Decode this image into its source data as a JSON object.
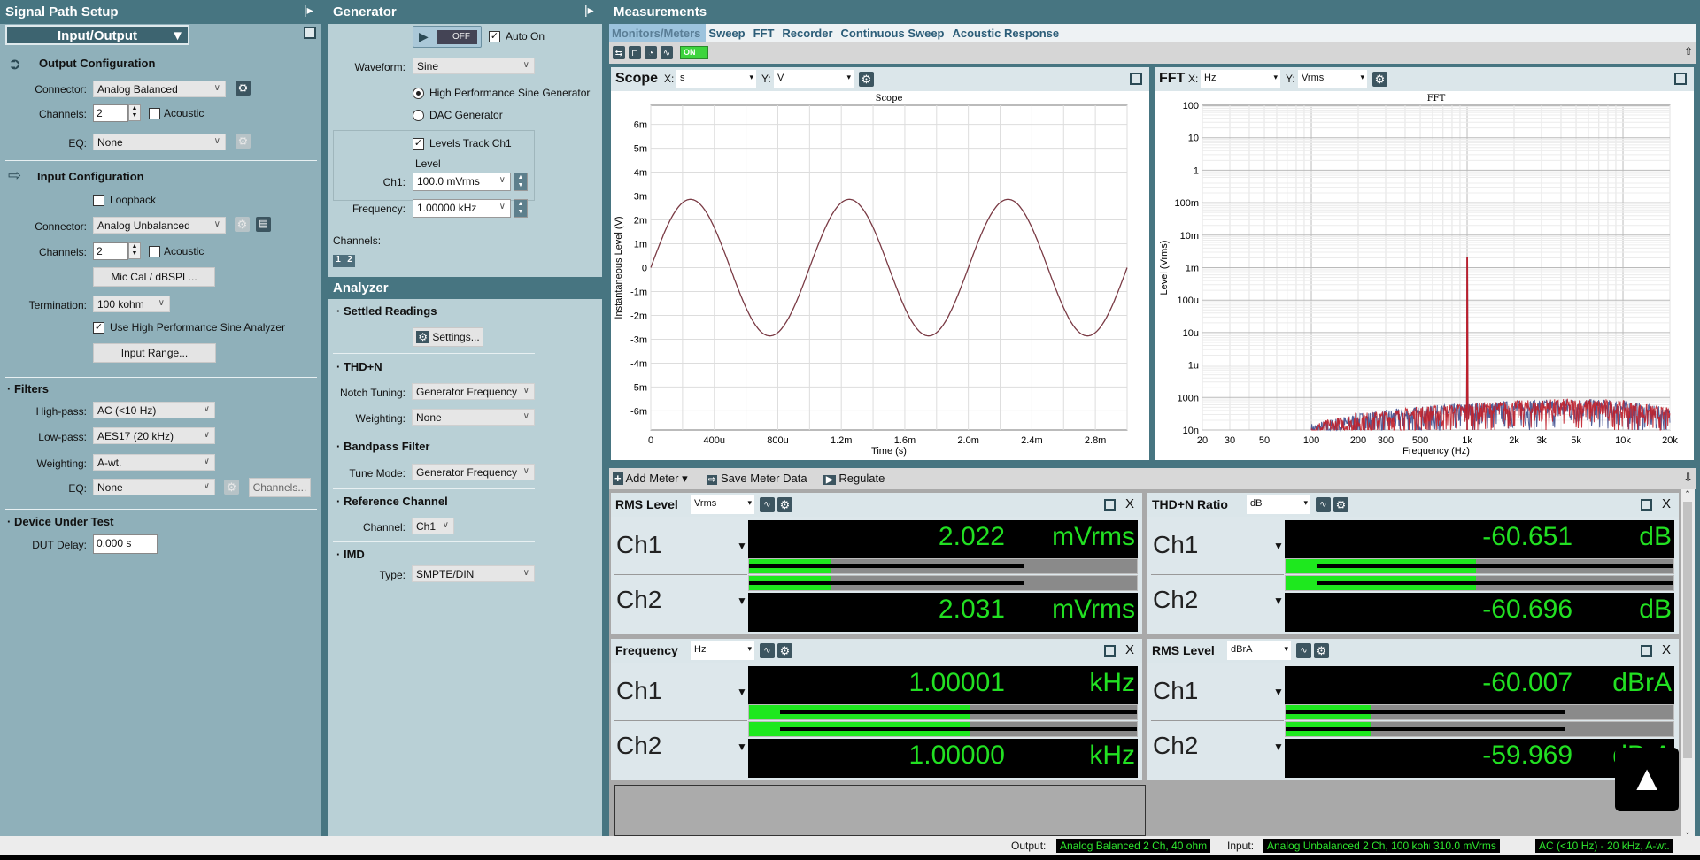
{
  "signal_path": {
    "title": "Signal Path Setup",
    "view": "Input/Output",
    "output": {
      "heading": "Output Configuration",
      "connector_label": "Connector:",
      "connector": "Analog Balanced",
      "channels_label": "Channels:",
      "channels": "2",
      "acoustic": "Acoustic",
      "acoustic_checked": false,
      "eq_label": "EQ:",
      "eq": "None"
    },
    "input": {
      "heading": "Input Configuration",
      "loopback": "Loopback",
      "loopback_checked": false,
      "connector_label": "Connector:",
      "connector": "Analog Unbalanced",
      "channels_label": "Channels:",
      "channels": "2",
      "acoustic": "Acoustic",
      "acoustic_checked": false,
      "mic_cal": "Mic Cal / dBSPL...",
      "termination_label": "Termination:",
      "termination": "100 kohm",
      "use_hp": "Use High Performance Sine Analyzer",
      "use_hp_checked": true,
      "input_range": "Input Range..."
    },
    "filters": {
      "heading": "Filters",
      "highpass_label": "High-pass:",
      "highpass": "AC (<10 Hz)",
      "lowpass_label": "Low-pass:",
      "lowpass": "AES17 (20 kHz)",
      "weighting_label": "Weighting:",
      "weighting": "A-wt.",
      "eq_label": "EQ:",
      "eq": "None",
      "channels_button": "Channels..."
    },
    "dut": {
      "heading": "Device Under Test",
      "delay_label": "DUT Delay:",
      "delay": "0.000 s"
    }
  },
  "generator": {
    "title": "Generator",
    "state": "OFF",
    "auto_on": "Auto On",
    "auto_on_checked": true,
    "waveform_label": "Waveform:",
    "waveform": "Sine",
    "hp_sine": "High Performance Sine Generator",
    "dac": "DAC Generator",
    "selected": "hp_sine",
    "levels_track": "Levels Track Ch1",
    "levels_track_checked": true,
    "level_label": "Level",
    "ch1_label": "Ch1:",
    "ch1": "100.0 mVrms",
    "frequency_label": "Frequency:",
    "frequency": "1.00000 kHz",
    "channels_label": "Channels:",
    "channel_buttons": [
      "1",
      "2"
    ]
  },
  "analyzer": {
    "title": "Analyzer",
    "settled": {
      "heading": "Settled Readings",
      "settings": "Settings..."
    },
    "thdn": {
      "heading": "THD+N",
      "notch_label": "Notch Tuning:",
      "notch": "Generator Frequency",
      "weighting_label": "Weighting:",
      "weighting": "None"
    },
    "bandpass": {
      "heading": "Bandpass Filter",
      "tune_label": "Tune Mode:",
      "tune": "Generator Frequency"
    },
    "reference": {
      "heading": "Reference Channel",
      "channel_label": "Channel:",
      "channel": "Ch1"
    },
    "imd": {
      "heading": "IMD",
      "type_label": "Type:",
      "type": "SMPTE/DIN"
    }
  },
  "measurements": {
    "title": "Measurements",
    "tabs": [
      "Monitors/Meters",
      "Sweep",
      "FFT",
      "Recorder",
      "Continuous Sweep",
      "Acoustic Response"
    ],
    "active_tab": 0,
    "monitor_toggle": "ON",
    "scope": {
      "title": "Scope",
      "x_label": "X:",
      "x_unit": "s",
      "y_label": "Y:",
      "y_unit": "V"
    },
    "fft": {
      "title": "FFT",
      "x_label": "X:",
      "x_unit": "Hz",
      "y_label": "Y:",
      "y_unit": "Vrms"
    },
    "meter_toolbar": {
      "add": "Add Meter",
      "save": "Save Meter Data",
      "regulate": "Regulate"
    },
    "meters": [
      {
        "title": "RMS Level",
        "unit": "Vrms",
        "channels": [
          {
            "name": "Ch1",
            "value": "2.022",
            "unit": "mVrms",
            "bar": 0.21,
            "peak": 0.71
          },
          {
            "name": "Ch2",
            "value": "2.031",
            "unit": "mVrms",
            "bar": 0.21,
            "peak": 0.71
          }
        ]
      },
      {
        "title": "THD+N Ratio",
        "unit": "dB",
        "channels": [
          {
            "name": "Ch1",
            "value": "-60.651",
            "unit": "dB",
            "bar": 0.49,
            "peak": 1.0
          },
          {
            "name": "Ch2",
            "value": "-60.696",
            "unit": "dB",
            "bar": 0.49,
            "peak": 1.0
          }
        ]
      },
      {
        "title": "Frequency",
        "unit": "Hz",
        "channels": [
          {
            "name": "Ch1",
            "value": "1.00001",
            "unit": "kHz",
            "bar": 0.57,
            "peak": 1.0
          },
          {
            "name": "Ch2",
            "value": "1.00000",
            "unit": "kHz",
            "bar": 0.57,
            "peak": 1.0
          }
        ]
      },
      {
        "title": "RMS Level",
        "unit": "dBrA",
        "channels": [
          {
            "name": "Ch1",
            "value": "-60.007",
            "unit": "dBrA",
            "bar": 0.22,
            "peak": 0.72
          },
          {
            "name": "Ch2",
            "value": "-59.969",
            "unit": "dBrA",
            "bar": 0.22,
            "peak": 0.72
          }
        ]
      }
    ]
  },
  "status": {
    "output_label": "Output:",
    "output": "Analog Balanced 2 Ch, 40 ohm",
    "input_label": "Input:",
    "input": "Analog Unbalanced 2 Ch, 100 kohm",
    "level": "310.0 mVrms",
    "filter": "AC (<10 Hz) - 20 kHz, A-wt."
  },
  "colors": {
    "header": "#477581",
    "meter_text": "#22e022",
    "meter_bar": "#1ee81e",
    "trace_ch1": "#3f4f8f",
    "trace_ch2": "#c01f2a",
    "scope_trace": "#7a3a44"
  },
  "chart_data": [
    {
      "type": "line",
      "title": "Scope",
      "xlabel": "Time (s)",
      "ylabel": "Instantaneous Level (V)",
      "xlim": [
        0,
        0.003
      ],
      "ylim": [
        -0.0068,
        0.0068
      ],
      "xticks": [
        0,
        0.0004,
        0.0008,
        0.0012,
        0.0016,
        0.002,
        0.0024,
        0.0028
      ],
      "xtick_labels": [
        "0",
        "400u",
        "800u",
        "1.2m",
        "1.6m",
        "2.0m",
        "2.4m",
        "2.8m"
      ],
      "yticks": [
        0.006,
        0.005,
        0.004,
        0.003,
        0.002,
        0.001,
        0,
        -0.001,
        -0.002,
        -0.003,
        -0.004,
        -0.005,
        -0.006
      ],
      "ytick_labels": [
        "6m",
        "5m",
        "4m",
        "3m",
        "2m",
        "1m",
        "0",
        "-1m",
        "-2m",
        "-3m",
        "-4m",
        "-5m",
        "-6m"
      ],
      "grid": true,
      "series": [
        {
          "waveform": "sine",
          "frequency_hz": 1000,
          "amplitude_v": 0.00286,
          "phase_deg": 0
        }
      ]
    },
    {
      "type": "line",
      "title": "FFT",
      "xlabel": "Frequency (Hz)",
      "ylabel": "Level (Vrms)",
      "x_scale": "log",
      "y_scale": "log",
      "xlim": [
        20,
        20000
      ],
      "ylim": [
        1e-08,
        100
      ],
      "xticks": [
        20,
        30,
        50,
        100,
        200,
        300,
        500,
        1000,
        2000,
        3000,
        5000,
        10000,
        20000
      ],
      "xtick_labels": [
        "20",
        "30",
        "50",
        "100",
        "200",
        "300",
        "500",
        "1k",
        "2k",
        "3k",
        "5k",
        "10k",
        "20k"
      ],
      "yticks": [
        100,
        10,
        1,
        0.1,
        0.01,
        0.001,
        0.0001,
        1e-05,
        1e-06,
        1e-07,
        1e-08
      ],
      "ytick_labels": [
        "100",
        "10",
        "1",
        "100m",
        "10m",
        "1m",
        "100u",
        "10u",
        "1u",
        "100n",
        "10n"
      ],
      "grid": true,
      "series": [
        {
          "color": "#3f4f8f",
          "peak": [
            1000,
            0.00202
          ],
          "noise_floor": [
            [
              100,
              1.2e-08
            ],
            [
              200,
              2.5e-08
            ],
            [
              300,
              3e-08
            ],
            [
              500,
              4e-08
            ],
            [
              1000,
              5e-08
            ],
            [
              2000,
              6e-08
            ],
            [
              5000,
              7e-08
            ],
            [
              10000,
              6e-08
            ],
            [
              20000,
              3.5e-08
            ]
          ]
        },
        {
          "color": "#c01f2a",
          "peak": [
            1000,
            0.00203
          ],
          "noise_floor": [
            [
              100,
              1.2e-08
            ],
            [
              200,
              2.5e-08
            ],
            [
              300,
              3e-08
            ],
            [
              500,
              4e-08
            ],
            [
              1000,
              5e-08
            ],
            [
              2000,
              6e-08
            ],
            [
              5000,
              7e-08
            ],
            [
              10000,
              6e-08
            ],
            [
              20000,
              3.5e-08
            ]
          ]
        }
      ]
    }
  ]
}
